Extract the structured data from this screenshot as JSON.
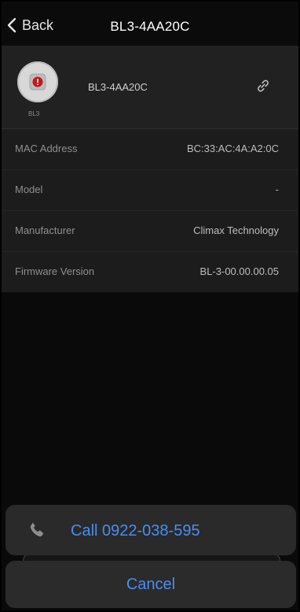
{
  "header": {
    "back_label": "Back",
    "title": "BL3-4AA20C"
  },
  "device": {
    "name": "BL3-4AA20C",
    "icon_caption": "BL3",
    "icon_name": "panic-button-device-icon"
  },
  "info": [
    {
      "label": "MAC Address",
      "value": "BC:33:AC:4A:A2:0C"
    },
    {
      "label": "Model",
      "value": "-"
    },
    {
      "label": "Manufacturer",
      "value": "Climax Technology"
    },
    {
      "label": "Firmware Version",
      "value": "BL-3-00.00.00.05"
    }
  ],
  "action_sheet": {
    "call_label": "Call 0922-038-595",
    "cancel_label": "Cancel"
  },
  "colors": {
    "accent": "#4a8df0",
    "background": "#0a0a0a",
    "card": "#212121",
    "device_button": "#c6161b"
  }
}
